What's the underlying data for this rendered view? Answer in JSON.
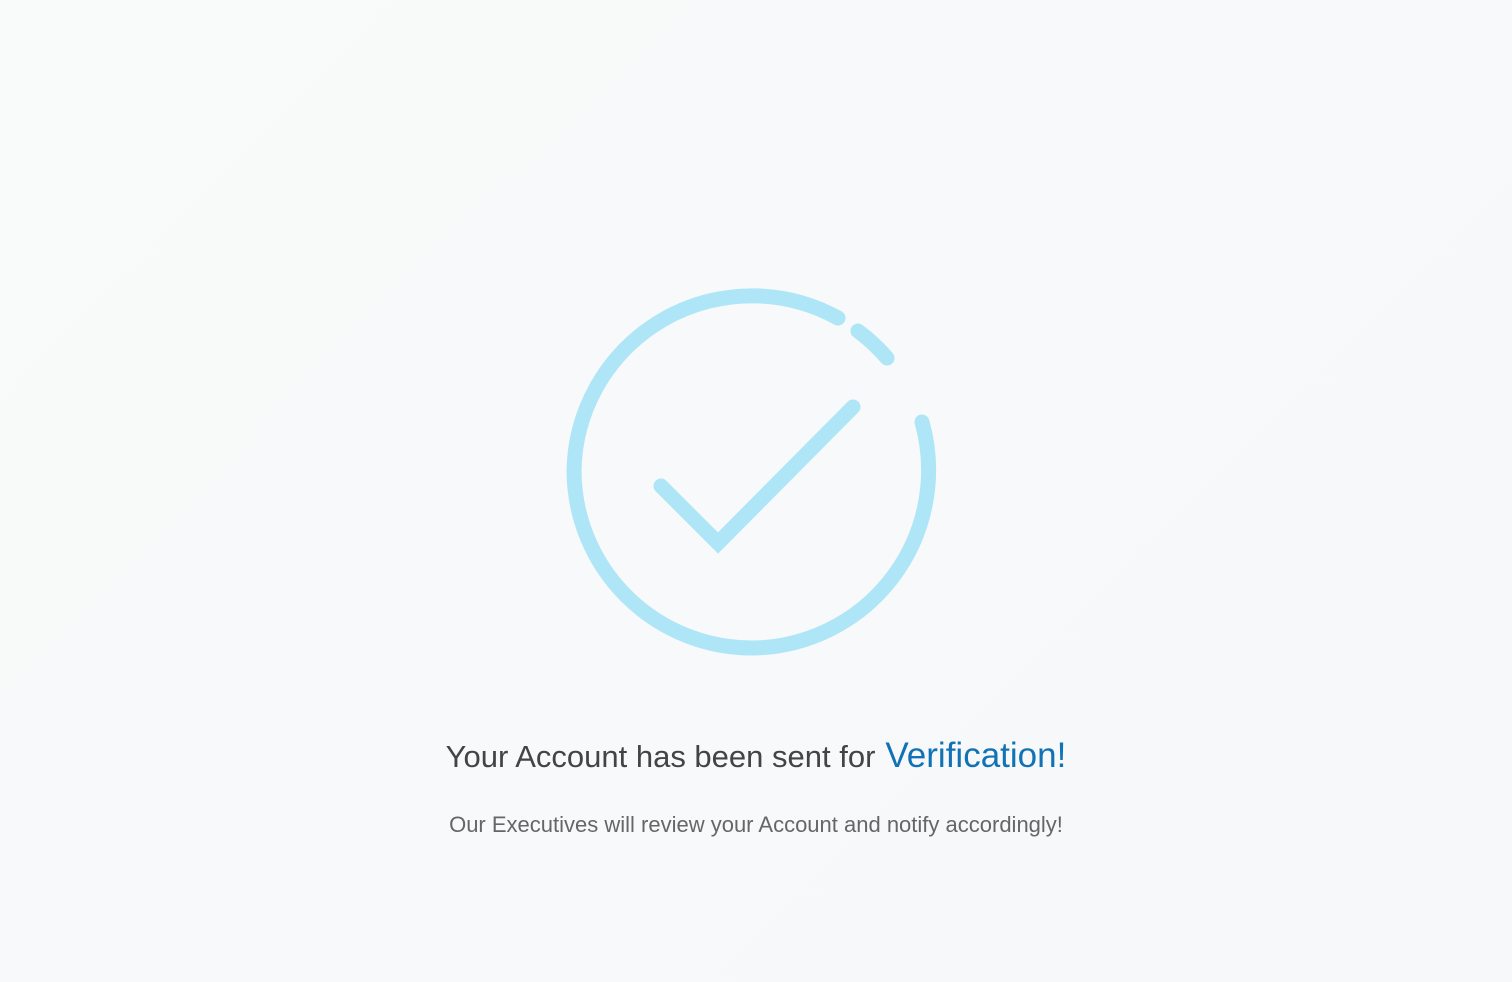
{
  "verification": {
    "icon": "check-circle-icon",
    "accent_color": "#aee6f7",
    "heading_lead": "Your Account has been sent for",
    "heading_highlight": "Verification!",
    "highlight_color": "#1173b6",
    "message": "Our Executives will review your Account and notify accordingly!"
  }
}
